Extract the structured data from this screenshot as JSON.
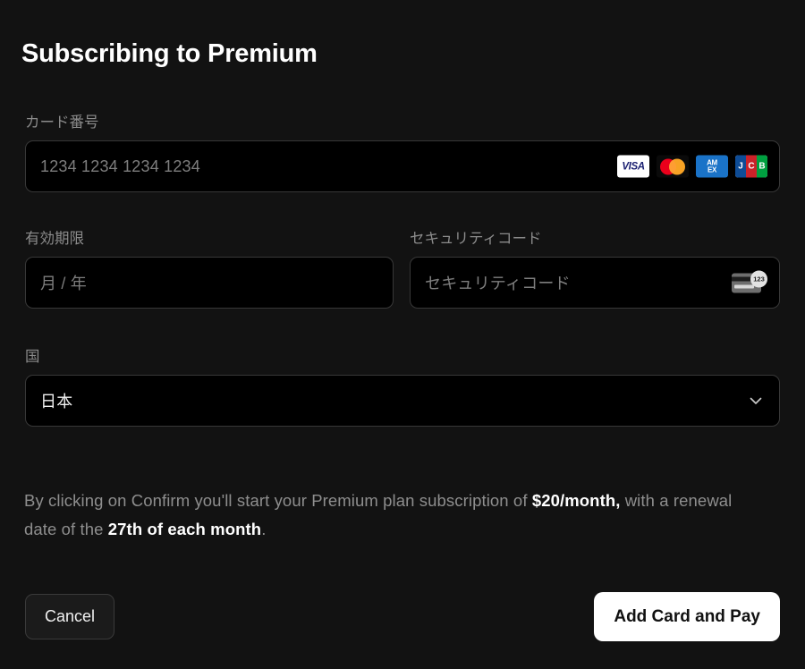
{
  "dialog": {
    "title": "Subscribing to Premium"
  },
  "card_number": {
    "label": "カード番号",
    "placeholder": "1234 1234 1234 1234",
    "brands": [
      {
        "name": "visa",
        "text": "VISA"
      },
      {
        "name": "mastercard",
        "text": ""
      },
      {
        "name": "amex",
        "line1": "AM",
        "line2": "EX"
      },
      {
        "name": "jcb",
        "j": "J",
        "c": "C",
        "b": "B"
      }
    ]
  },
  "expiry": {
    "label": "有効期限",
    "placeholder": "月 / 年"
  },
  "security_code": {
    "label": "セキュリティコード",
    "placeholder": "セキュリティコード",
    "icon_badge": "123"
  },
  "country": {
    "label": "国",
    "value": "日本"
  },
  "disclaimer": {
    "part1": "By clicking on Confirm you'll start your Premium plan subscription of ",
    "amount": "$20/month,",
    "part2": " with a renewal date of the ",
    "renewal": "27th of each month",
    "part3": "."
  },
  "buttons": {
    "cancel": "Cancel",
    "submit": "Add Card and Pay"
  },
  "colors": {
    "background": "#121212",
    "input_background": "#000000",
    "input_border": "#383838",
    "label": "#8b8b8b",
    "placeholder": "#7e7e7e",
    "primary_button": "#ffffff",
    "visa_blue": "#1a1f71",
    "mastercard_red": "#eb001b",
    "mastercard_orange": "#f79e1b",
    "amex_blue": "#1a73c8",
    "jcb_blue": "#0e4c96",
    "jcb_red": "#cc2229",
    "jcb_green": "#00a040"
  }
}
